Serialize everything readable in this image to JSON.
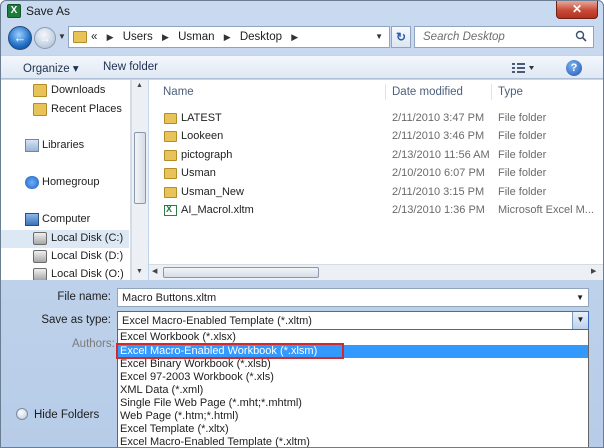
{
  "window": {
    "title": "Save As",
    "close_glyph": "✕",
    "app_icon": "excel-icon"
  },
  "address": {
    "segments": [
      "Users",
      "Usman",
      "Desktop"
    ],
    "prefix": "«"
  },
  "search": {
    "placeholder": "Search Desktop"
  },
  "toolbar": {
    "organize": "Organize ▾",
    "new_folder": "New folder",
    "help_glyph": "?"
  },
  "navpane": {
    "items": [
      {
        "label": "Downloads",
        "icon": "folder-icon"
      },
      {
        "label": "Recent Places",
        "icon": "recent-places-icon"
      },
      {
        "label": "Libraries",
        "icon": "libraries-icon"
      },
      {
        "label": "Homegroup",
        "icon": "homegroup-icon"
      },
      {
        "label": "Computer",
        "icon": "computer-icon"
      },
      {
        "label": "Local Disk (C:)",
        "icon": "disk-icon"
      },
      {
        "label": "Local Disk (D:)",
        "icon": "disk-icon"
      },
      {
        "label": "Local Disk (O:)",
        "icon": "disk-icon"
      }
    ]
  },
  "filelist": {
    "columns": {
      "name": "Name",
      "date": "Date modified",
      "type": "Type"
    },
    "rows": [
      {
        "name": "LATEST",
        "date": "2/11/2010 3:47 PM",
        "type": "File folder"
      },
      {
        "name": "Lookeen",
        "date": "2/11/2010 3:46 PM",
        "type": "File folder"
      },
      {
        "name": "pictograph",
        "date": "2/13/2010 11:56 AM",
        "type": "File folder"
      },
      {
        "name": "Usman",
        "date": "2/10/2010 6:07 PM",
        "type": "File folder"
      },
      {
        "name": "Usman_New",
        "date": "2/11/2010 3:15 PM",
        "type": "File folder"
      },
      {
        "name": "AI_Macrol.xltm",
        "date": "2/13/2010 1:36 PM",
        "type": "Microsoft Excel M..."
      }
    ]
  },
  "form": {
    "filename_label": "File name:",
    "filename_value": "Macro Buttons.xltm",
    "type_label": "Save as type:",
    "type_value": "Excel Macro-Enabled Template (*.xltm)",
    "authors_label": "Authors:",
    "hide_folders": "Hide Folders"
  },
  "dropdown": {
    "options": [
      "Excel Workbook (*.xlsx)",
      "Excel Macro-Enabled Workbook (*.xlsm)",
      "Excel Binary Workbook (*.xlsb)",
      "Excel 97-2003 Workbook (*.xls)",
      "XML Data (*.xml)",
      "Single File Web Page (*.mht;*.mhtml)",
      "Web Page (*.htm;*.html)",
      "Excel Template (*.xltx)",
      "Excel Macro-Enabled Template (*.xltm)"
    ],
    "selected_index": 1
  },
  "colors": {
    "selection": "#3399ff",
    "highlight_box": "#d12a2a",
    "excel_green": "#1f7a3e"
  }
}
